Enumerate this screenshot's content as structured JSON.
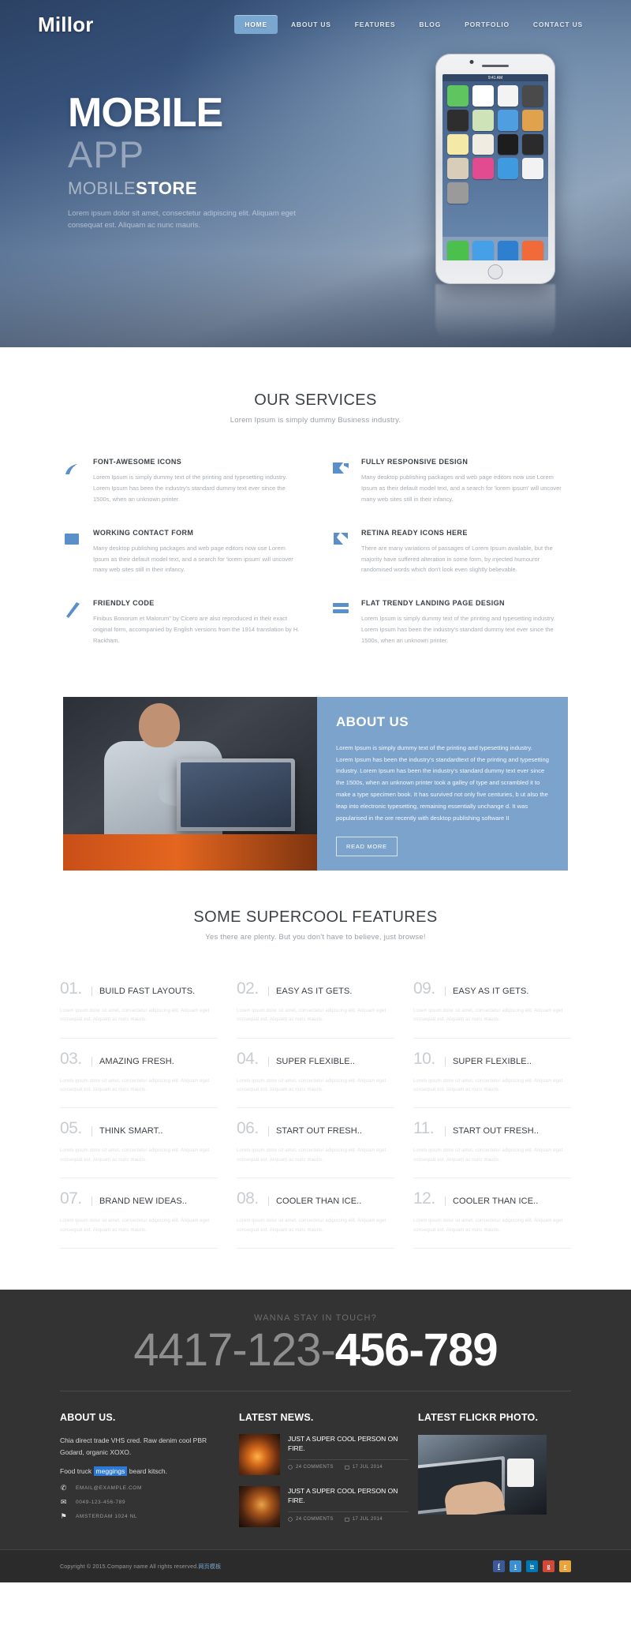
{
  "header": {
    "logo": "Millor",
    "nav": [
      {
        "label": "HOME",
        "active": true
      },
      {
        "label": "ABOUT US",
        "active": false
      },
      {
        "label": "FEATURES",
        "active": false
      },
      {
        "label": "BLOG",
        "active": false
      },
      {
        "label": "PORTFOLIO",
        "active": false
      },
      {
        "label": "CONTACT US",
        "active": false
      }
    ],
    "active_color": "#7aa7d0"
  },
  "hero": {
    "title": "MOBILE",
    "subtitle": "APP",
    "tagline_thin": "MOBILE",
    "tagline_bold": "STORE",
    "paragraph": "Lorem ipsum dolor sit amet, consectetur adipiscing elit. Aliquam eget consequat est. Aliquam ac nunc mauris.",
    "phone": {
      "status_time": "9:41 AM"
    }
  },
  "services": {
    "title": "OUR SERVICES",
    "subtitle": "Lorem Ipsum is simply dummy Business industry.",
    "items": [
      {
        "icon": "font-awesome-icon",
        "title": "FONT-AWESOME ICONS",
        "text": "Lorem Ipsum is simply dummy text of the printing and typesetting industry. Lorem Ipsum has been the industry's standard dummy text ever since the 1500s, when an unknown printer."
      },
      {
        "icon": "responsive-design-icon",
        "title": "FULLY RESPONSIVE DESIGN",
        "text": "Many desktop publishing packages and web page editors now use Lorem Ipsum as their default model text, and a search for 'lorem ipsum' will uncover many web sites still in their infancy."
      },
      {
        "icon": "contact-form-icon",
        "title": "WORKING CONTACT FORM",
        "text": "Many desktop publishing packages and web page editors now use Lorem Ipsum as their default model text, and a search for 'lorem ipsum' will uncover many web sites still in their infancy."
      },
      {
        "icon": "retina-icon",
        "title": "RETINA READY ICONS HERE",
        "text": "There are many variations of passages of Lorem Ipsum available, but the majority have suffered alteration in some form, by injected humouror randomised words which don't look even slightly believable."
      },
      {
        "icon": "friendly-code-icon",
        "title": "FRIENDLY CODE",
        "text": "Finibus Bonorum et Malorum\" by Cicero are also reproduced in their exact original form, accompanied by English versions from the 1914 translation by H. Rackham."
      },
      {
        "icon": "landing-page-icon",
        "title": "FLAT TRENDY LANDING PAGE DESIGN",
        "text": "Lorem Ipsum is simply dummy text of the printing and typesetting industry. Lorem Ipsum has been the industry's standard dummy text ever since the 1500s, when an unknown printer."
      }
    ]
  },
  "about": {
    "heading": "ABOUT US",
    "text": "Lorem Ipsum is simply dummy text of the printing and typesetting industry. Lorem Ipsum has been the industry's standardtext of the printing and typesetting industry. Lorem Ipsum has been the industry's standard dummy text ever since the 1500s, when an unknown printer took a galley of type and scrambled it to make a type specimen book. It has survived not only five centuries, b ut also the leap into electronic typesetting, remaining essentially unchange d. It was popularised in the ore recently with desktop publishing software II",
    "button": "READ MORE",
    "bg_color": "#7ba3cc"
  },
  "features": {
    "title": "SOME SUPERCOOL FEATURES",
    "subtitle": "Yes there are plenty. But you don't have to believe, just browse!",
    "body_text": "Lorem ipsum dolor sit amet, consectetur adipiscing elit. Aliquam eget consequat est. Aliquam ac nunc mauris.",
    "items": [
      {
        "num": "01.",
        "name": "BUILD FAST LAYOUTS."
      },
      {
        "num": "02.",
        "name": "EASY AS IT GETS."
      },
      {
        "num": "09.",
        "name": "EASY AS IT GETS."
      },
      {
        "num": "03.",
        "name": "AMAZING FRESH."
      },
      {
        "num": "04.",
        "name": "SUPER FLEXIBLE.."
      },
      {
        "num": "10.",
        "name": "SUPER FLEXIBLE.."
      },
      {
        "num": "05.",
        "name": "THINK SMART.."
      },
      {
        "num": "06.",
        "name": "START OUT FRESH.."
      },
      {
        "num": "11.",
        "name": "START OUT FRESH.."
      },
      {
        "num": "07.",
        "name": "BRAND NEW IDEAS.."
      },
      {
        "num": "08.",
        "name": "COOLER THAN ICE.."
      },
      {
        "num": "12.",
        "name": "COOLER THAN ICE.."
      }
    ]
  },
  "footer": {
    "tagline": "WANNA STAY IN TOUCH?",
    "phone_thin": "4417-123-",
    "phone_bold": "456-789",
    "about": {
      "heading": "ABOUT US.",
      "p1": "Chia direct trade VHS cred. Raw denim cool PBR Godard, organic XOXO.",
      "p2_before": "Food truck ",
      "p2_highlight": "meggings",
      "p2_after": " beard kitsch.",
      "contacts": [
        {
          "icon": "phone-icon",
          "glyph": "✆",
          "text": "EMAIL@EXAMPLE.COM"
        },
        {
          "icon": "envelope-icon",
          "glyph": "✉",
          "text": "0049-123-456-789"
        },
        {
          "icon": "map-pin-icon",
          "glyph": "⚑",
          "text": "AMSTERDAM 1024 NL"
        }
      ]
    },
    "news": {
      "heading": "LATEST NEWS.",
      "items": [
        {
          "title": "JUST A SUPER COOL PERSON ON FIRE.",
          "comments": "24 COMMENTS",
          "date": "17 JUL 2014"
        },
        {
          "title": "JUST A SUPER COOL PERSON ON FIRE.",
          "comments": "24 COMMENTS",
          "date": "17 JUL 2014"
        }
      ]
    },
    "flickr": {
      "heading": "LATEST FLICKR PHOTO."
    },
    "copyright_before": "Copyright © 2015.Company name All rights reserved.",
    "copyright_cn": "网页模板",
    "socials": [
      {
        "name": "facebook",
        "glyph": "f",
        "color": "#3b5998"
      },
      {
        "name": "twitter",
        "glyph": "t",
        "color": "#3b8fd0"
      },
      {
        "name": "linkedin",
        "glyph": "in",
        "color": "#0077b5"
      },
      {
        "name": "google-plus",
        "glyph": "g",
        "color": "#d34836"
      },
      {
        "name": "rss",
        "glyph": "r",
        "color": "#e8a33d"
      }
    ]
  }
}
